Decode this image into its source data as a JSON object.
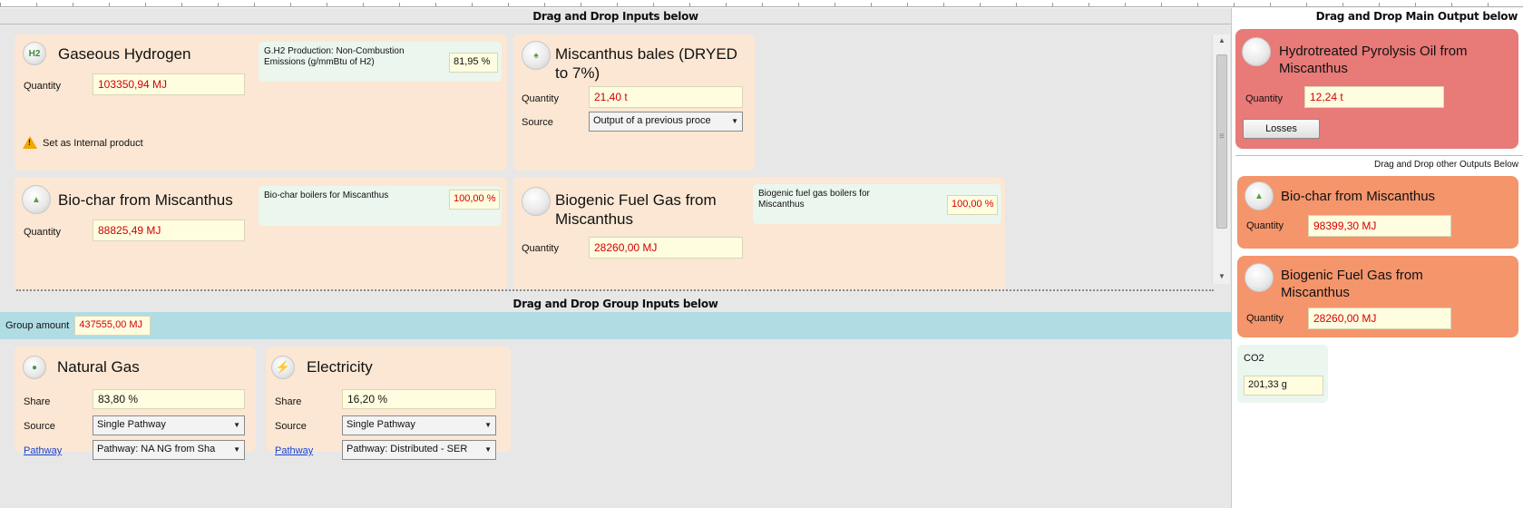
{
  "headers": {
    "inputs": "Drag and Drop Inputs below",
    "group_inputs": "Drag and Drop Group Inputs below",
    "main_output": "Drag and Drop Main Output below",
    "other_outputs": "Drag and Drop other Outputs Below"
  },
  "inputs": [
    {
      "title": "Gaseous Hydrogen",
      "icon": "h2-icon",
      "icon_text": "H2",
      "quantity_label": "Quantity",
      "quantity": "103350,94 MJ",
      "emission_text": "G.H2 Production: Non-Combustion Emissions (g/mmBtu of H2)",
      "emission_pct": "81,95 %",
      "warning": "Set as Internal product"
    },
    {
      "title": "Miscanthus bales (DRYED to 7%)",
      "icon": "plant-icon",
      "quantity_label": "Quantity",
      "quantity": "21,40 t",
      "source_label": "Source",
      "source": "Output of a previous proce"
    },
    {
      "title": "Bio-char from Miscanthus",
      "icon": "biochar-icon",
      "quantity_label": "Quantity",
      "quantity": "88825,49 MJ",
      "emission_text": "Bio-char boilers for Miscanthus",
      "emission_pct": "100,00 %"
    },
    {
      "title": "Biogenic Fuel Gas from Miscanthus",
      "icon": "empty-circle-icon",
      "quantity_label": "Quantity",
      "quantity": "28260,00 MJ",
      "emission_text": "Biogenic fuel gas boilers for Miscanthus",
      "emission_pct": "100,00 %"
    }
  ],
  "group": {
    "amount_label": "Group amount",
    "amount": "437555,00 MJ",
    "items": [
      {
        "title": "Natural Gas",
        "icon": "natural-gas-icon",
        "share_label": "Share",
        "share": "83,80 %",
        "source_label": "Source",
        "source": "Single Pathway",
        "pathway_label": "Pathway",
        "pathway": "Pathway: NA NG from Sha"
      },
      {
        "title": "Electricity",
        "icon": "lightning-icon",
        "share_label": "Share",
        "share": "16,20 %",
        "source_label": "Source",
        "source": "Single Pathway",
        "pathway_label": "Pathway",
        "pathway": "Pathway: Distributed - SER"
      }
    ]
  },
  "main_output": {
    "title": "Hydrotreated Pyrolysis Oil from Miscanthus",
    "quantity_label": "Quantity",
    "quantity": "12,24 t",
    "losses_label": "Losses",
    "color": "#e87a78"
  },
  "other_outputs": [
    {
      "title": "Bio-char from Miscanthus",
      "quantity_label": "Quantity",
      "quantity": "98399,30 MJ",
      "color": "#f4956c"
    },
    {
      "title": "Biogenic Fuel Gas from Miscanthus",
      "quantity_label": "Quantity",
      "quantity": "28260,00 MJ",
      "color": "#f4956c"
    }
  ],
  "emissions": {
    "label": "CO2",
    "value": "201,33 g"
  }
}
